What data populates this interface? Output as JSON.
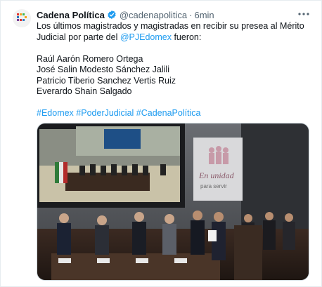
{
  "tweet": {
    "author_name": "Cadena Política",
    "handle": "@cadenapolitica",
    "separator": "·",
    "time": "6min",
    "text_line1": "Los últimos magistrados y magistradas en recibir su presea al Mérito",
    "text_line2_before": "Judicial por parte del ",
    "text_mention": "@PJEdomex",
    "text_line2_after": " fueron:",
    "honorees": [
      "Raúl Aarón Romero Ortega",
      "José Salin Modesto Sánchez Jalili",
      "Patricio Tiberio Sanchez Vertis Ruiz",
      "Everardo Shain Salgado"
    ],
    "hashtags": [
      "#Edomex",
      "#PoderJudicial",
      "#CadenaPolítica"
    ]
  },
  "photo": {
    "banner_line1": "En unidad",
    "banner_line2": "para servir"
  },
  "icons": {
    "verified": "verified-badge-icon",
    "more": "more-options-icon"
  },
  "colors": {
    "link": "#1d9bf0",
    "text": "#0f1419",
    "muted": "#536471",
    "verified": "#1d9bf0"
  }
}
